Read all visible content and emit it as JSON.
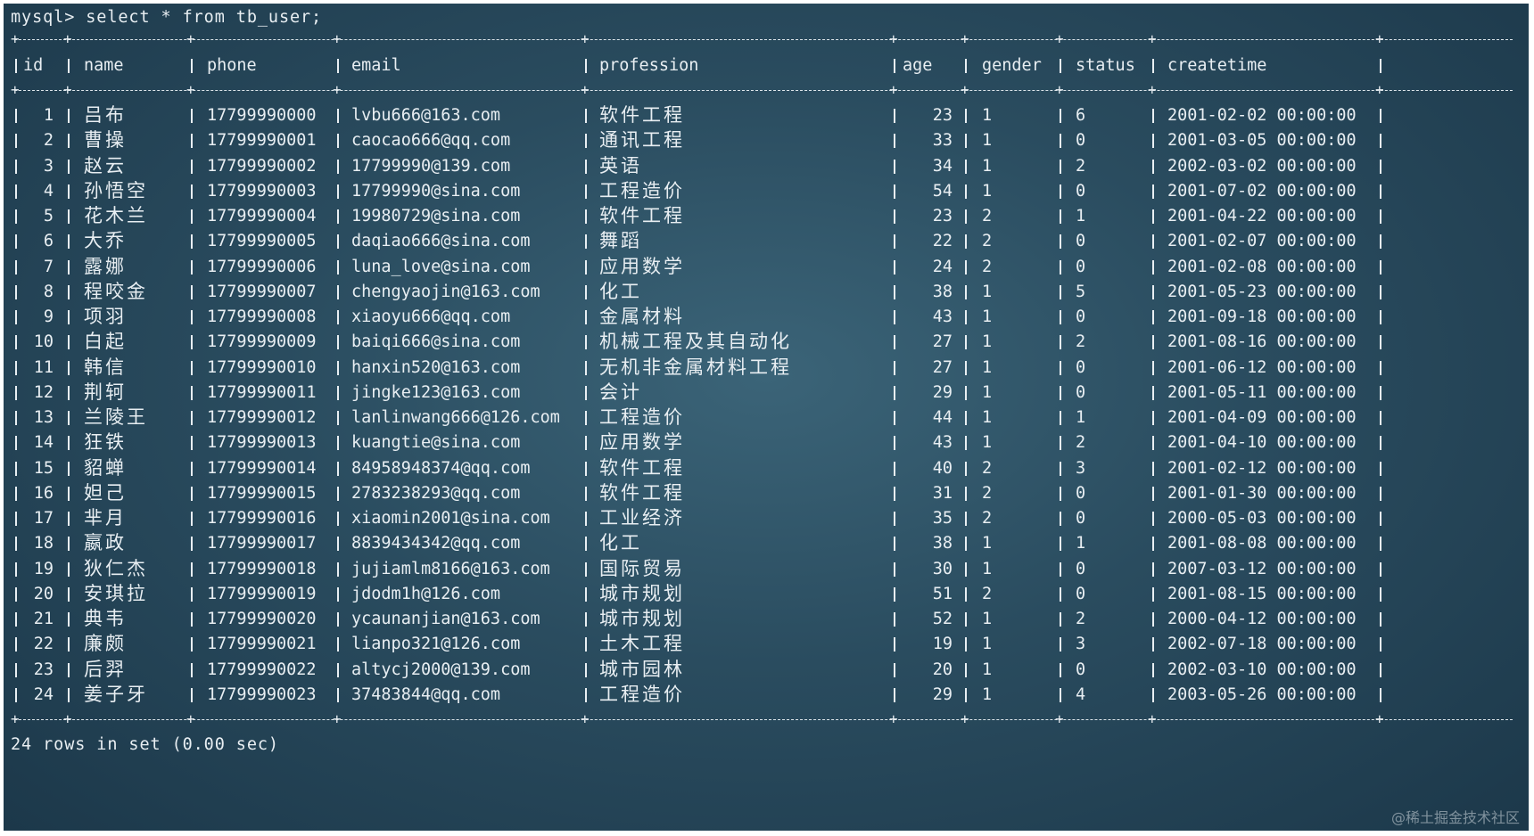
{
  "prompt": "mysql> select * from tb_user;",
  "columns": [
    "id",
    "name",
    "phone",
    "email",
    "profession",
    "age",
    "gender",
    "status",
    "createtime"
  ],
  "rows": [
    [
      "1",
      "吕布",
      "17799990000",
      "lvbu666@163.com",
      "软件工程",
      "23",
      "1",
      "6",
      "2001-02-02 00:00:00"
    ],
    [
      "2",
      "曹操",
      "17799990001",
      "caocao666@qq.com",
      "通讯工程",
      "33",
      "1",
      "0",
      "2001-03-05 00:00:00"
    ],
    [
      "3",
      "赵云",
      "17799990002",
      "17799990@139.com",
      "英语",
      "34",
      "1",
      "2",
      "2002-03-02 00:00:00"
    ],
    [
      "4",
      "孙悟空",
      "17799990003",
      "17799990@sina.com",
      "工程造价",
      "54",
      "1",
      "0",
      "2001-07-02 00:00:00"
    ],
    [
      "5",
      "花木兰",
      "17799990004",
      "19980729@sina.com",
      "软件工程",
      "23",
      "2",
      "1",
      "2001-04-22 00:00:00"
    ],
    [
      "6",
      "大乔",
      "17799990005",
      "daqiao666@sina.com",
      "舞蹈",
      "22",
      "2",
      "0",
      "2001-02-07 00:00:00"
    ],
    [
      "7",
      "露娜",
      "17799990006",
      "luna_love@sina.com",
      "应用数学",
      "24",
      "2",
      "0",
      "2001-02-08 00:00:00"
    ],
    [
      "8",
      "程咬金",
      "17799990007",
      "chengyaojin@163.com",
      "化工",
      "38",
      "1",
      "5",
      "2001-05-23 00:00:00"
    ],
    [
      "9",
      "项羽",
      "17799990008",
      "xiaoyu666@qq.com",
      "金属材料",
      "43",
      "1",
      "0",
      "2001-09-18 00:00:00"
    ],
    [
      "10",
      "白起",
      "17799990009",
      "baiqi666@sina.com",
      "机械工程及其自动化",
      "27",
      "1",
      "2",
      "2001-08-16 00:00:00"
    ],
    [
      "11",
      "韩信",
      "17799990010",
      "hanxin520@163.com",
      "无机非金属材料工程",
      "27",
      "1",
      "0",
      "2001-06-12 00:00:00"
    ],
    [
      "12",
      "荆轲",
      "17799990011",
      "jingke123@163.com",
      "会计",
      "29",
      "1",
      "0",
      "2001-05-11 00:00:00"
    ],
    [
      "13",
      "兰陵王",
      "17799990012",
      "lanlinwang666@126.com",
      "工程造价",
      "44",
      "1",
      "1",
      "2001-04-09 00:00:00"
    ],
    [
      "14",
      "狂铁",
      "17799990013",
      "kuangtie@sina.com",
      "应用数学",
      "43",
      "1",
      "2",
      "2001-04-10 00:00:00"
    ],
    [
      "15",
      "貂蝉",
      "17799990014",
      "84958948374@qq.com",
      "软件工程",
      "40",
      "2",
      "3",
      "2001-02-12 00:00:00"
    ],
    [
      "16",
      "妲己",
      "17799990015",
      "2783238293@qq.com",
      "软件工程",
      "31",
      "2",
      "0",
      "2001-01-30 00:00:00"
    ],
    [
      "17",
      "芈月",
      "17799990016",
      "xiaomin2001@sina.com",
      "工业经济",
      "35",
      "2",
      "0",
      "2000-05-03 00:00:00"
    ],
    [
      "18",
      "嬴政",
      "17799990017",
      "8839434342@qq.com",
      "化工",
      "38",
      "1",
      "1",
      "2001-08-08 00:00:00"
    ],
    [
      "19",
      "狄仁杰",
      "17799990018",
      "jujiamlm8166@163.com",
      "国际贸易",
      "30",
      "1",
      "0",
      "2007-03-12 00:00:00"
    ],
    [
      "20",
      "安琪拉",
      "17799990019",
      "jdodm1h@126.com",
      "城市规划",
      "51",
      "2",
      "0",
      "2001-08-15 00:00:00"
    ],
    [
      "21",
      "典韦",
      "17799990020",
      "ycaunanjian@163.com",
      "城市规划",
      "52",
      "1",
      "2",
      "2000-04-12 00:00:00"
    ],
    [
      "22",
      "廉颇",
      "17799990021",
      "lianpo321@126.com",
      "土木工程",
      "19",
      "1",
      "3",
      "2002-07-18 00:00:00"
    ],
    [
      "23",
      "后羿",
      "17799990022",
      "altycj2000@139.com",
      "城市园林",
      "20",
      "1",
      "0",
      "2002-03-10 00:00:00"
    ],
    [
      "24",
      "姜子牙",
      "17799990023",
      "37483844@qq.com",
      "工程造价",
      "29",
      "1",
      "4",
      "2003-05-26 00:00:00"
    ]
  ],
  "footer": "24 rows in set (0.00 sec)",
  "watermark": "@稀土掘金技术社区"
}
